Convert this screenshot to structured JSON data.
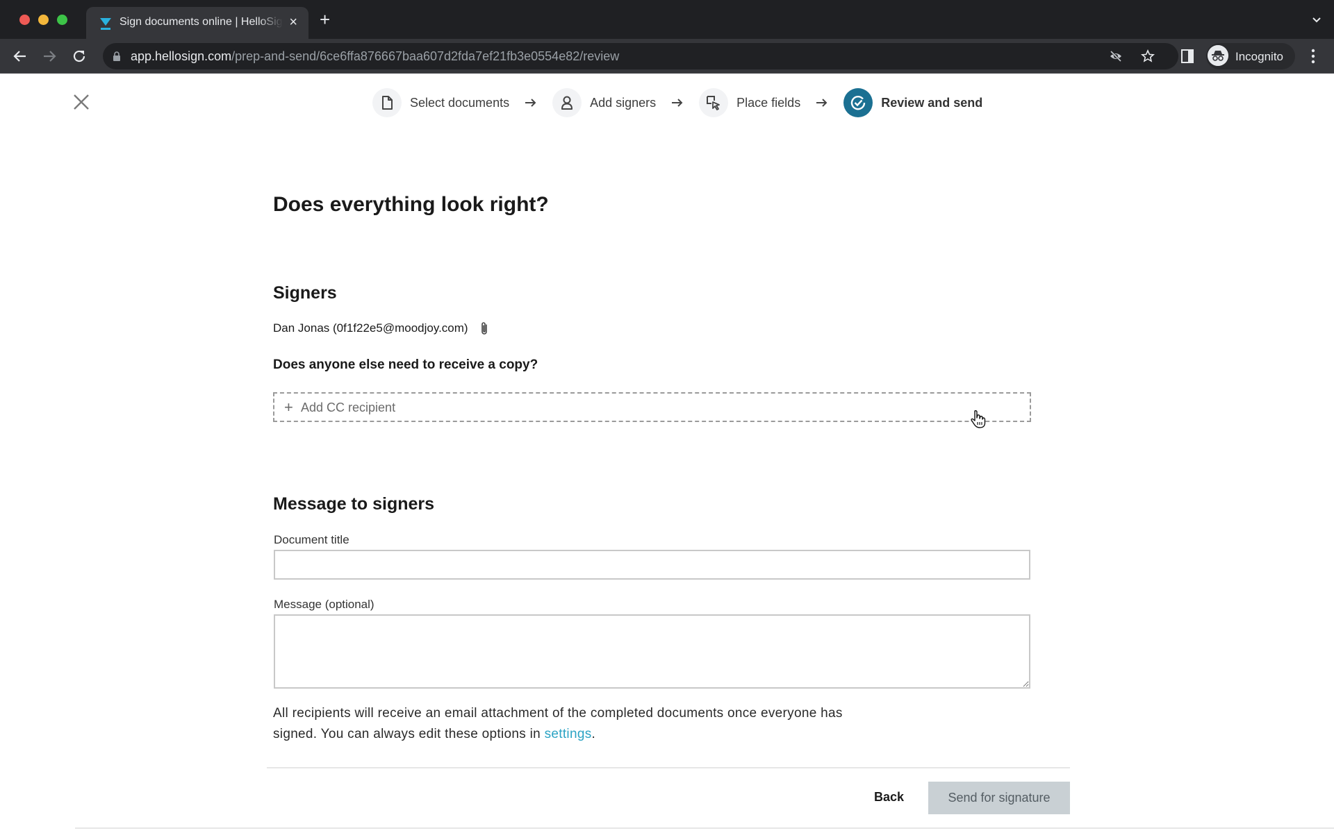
{
  "browser": {
    "tab_title": "Sign documents online | HelloSign",
    "tab_close": "×",
    "new_tab": "+",
    "url_host": "app.hellosign.com",
    "url_path": "/prep-and-send/6ce6ffa876667baa607d2fda7ef21fb3e0554e82/review",
    "profile_label": "Incognito"
  },
  "stepper": {
    "steps": [
      {
        "label": "Select documents",
        "icon": "document-icon",
        "state": "done"
      },
      {
        "label": "Add signers",
        "icon": "person-icon",
        "state": "done"
      },
      {
        "label": "Place fields",
        "icon": "place-field-icon",
        "state": "done"
      },
      {
        "label": "Review and send",
        "icon": "check-circle-icon",
        "state": "active"
      }
    ]
  },
  "page": {
    "title": "Does everything look right?",
    "signers_heading": "Signers",
    "signer": "Dan Jonas (0f1f22e5@moodjoy.com)",
    "cc_question": "Does anyone else need to receive a copy?",
    "cc_plus": "+",
    "cc_button": "Add CC recipient",
    "message_heading": "Message to signers",
    "doc_title_label": "Document title",
    "doc_title_value": "",
    "message_label": "Message (optional)",
    "message_value": "",
    "note_text": "All recipients will receive an email attachment of the completed documents once everyone has signed. You can always edit these options in ",
    "note_link": "settings",
    "note_end": "."
  },
  "footer": {
    "back_label": "Back",
    "send_label": "Send for signature"
  },
  "colors": {
    "accent": "#1b7092",
    "link": "#2ba3c4",
    "disabled_button": "#c9d0d4"
  }
}
